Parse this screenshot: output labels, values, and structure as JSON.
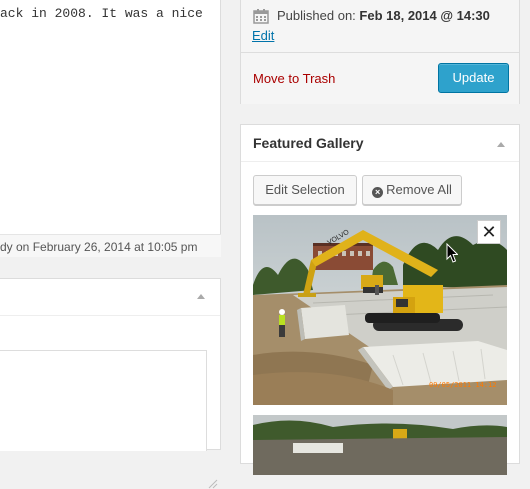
{
  "editor": {
    "text_line": "ack in 2008. It was a nice",
    "status_text": "dy on February 26, 2014 at 10:05 pm"
  },
  "publish": {
    "published_label": "Published on:",
    "published_date": "Feb 18, 2014 @ 14:30",
    "edit_link": "Edit",
    "trash_link": "Move to Trash",
    "update_button": "Update"
  },
  "gallery": {
    "title": "Featured Gallery",
    "edit_selection": "Edit Selection",
    "remove_all": "Remove All",
    "photo1": {
      "close_label": "✕",
      "stamp": "09/05/2011 14:12",
      "brand_text": "VOLVO"
    }
  },
  "colors": {
    "link": "#0073aa",
    "trash": "#aa0000",
    "update_bg": "#2ea2cc"
  }
}
